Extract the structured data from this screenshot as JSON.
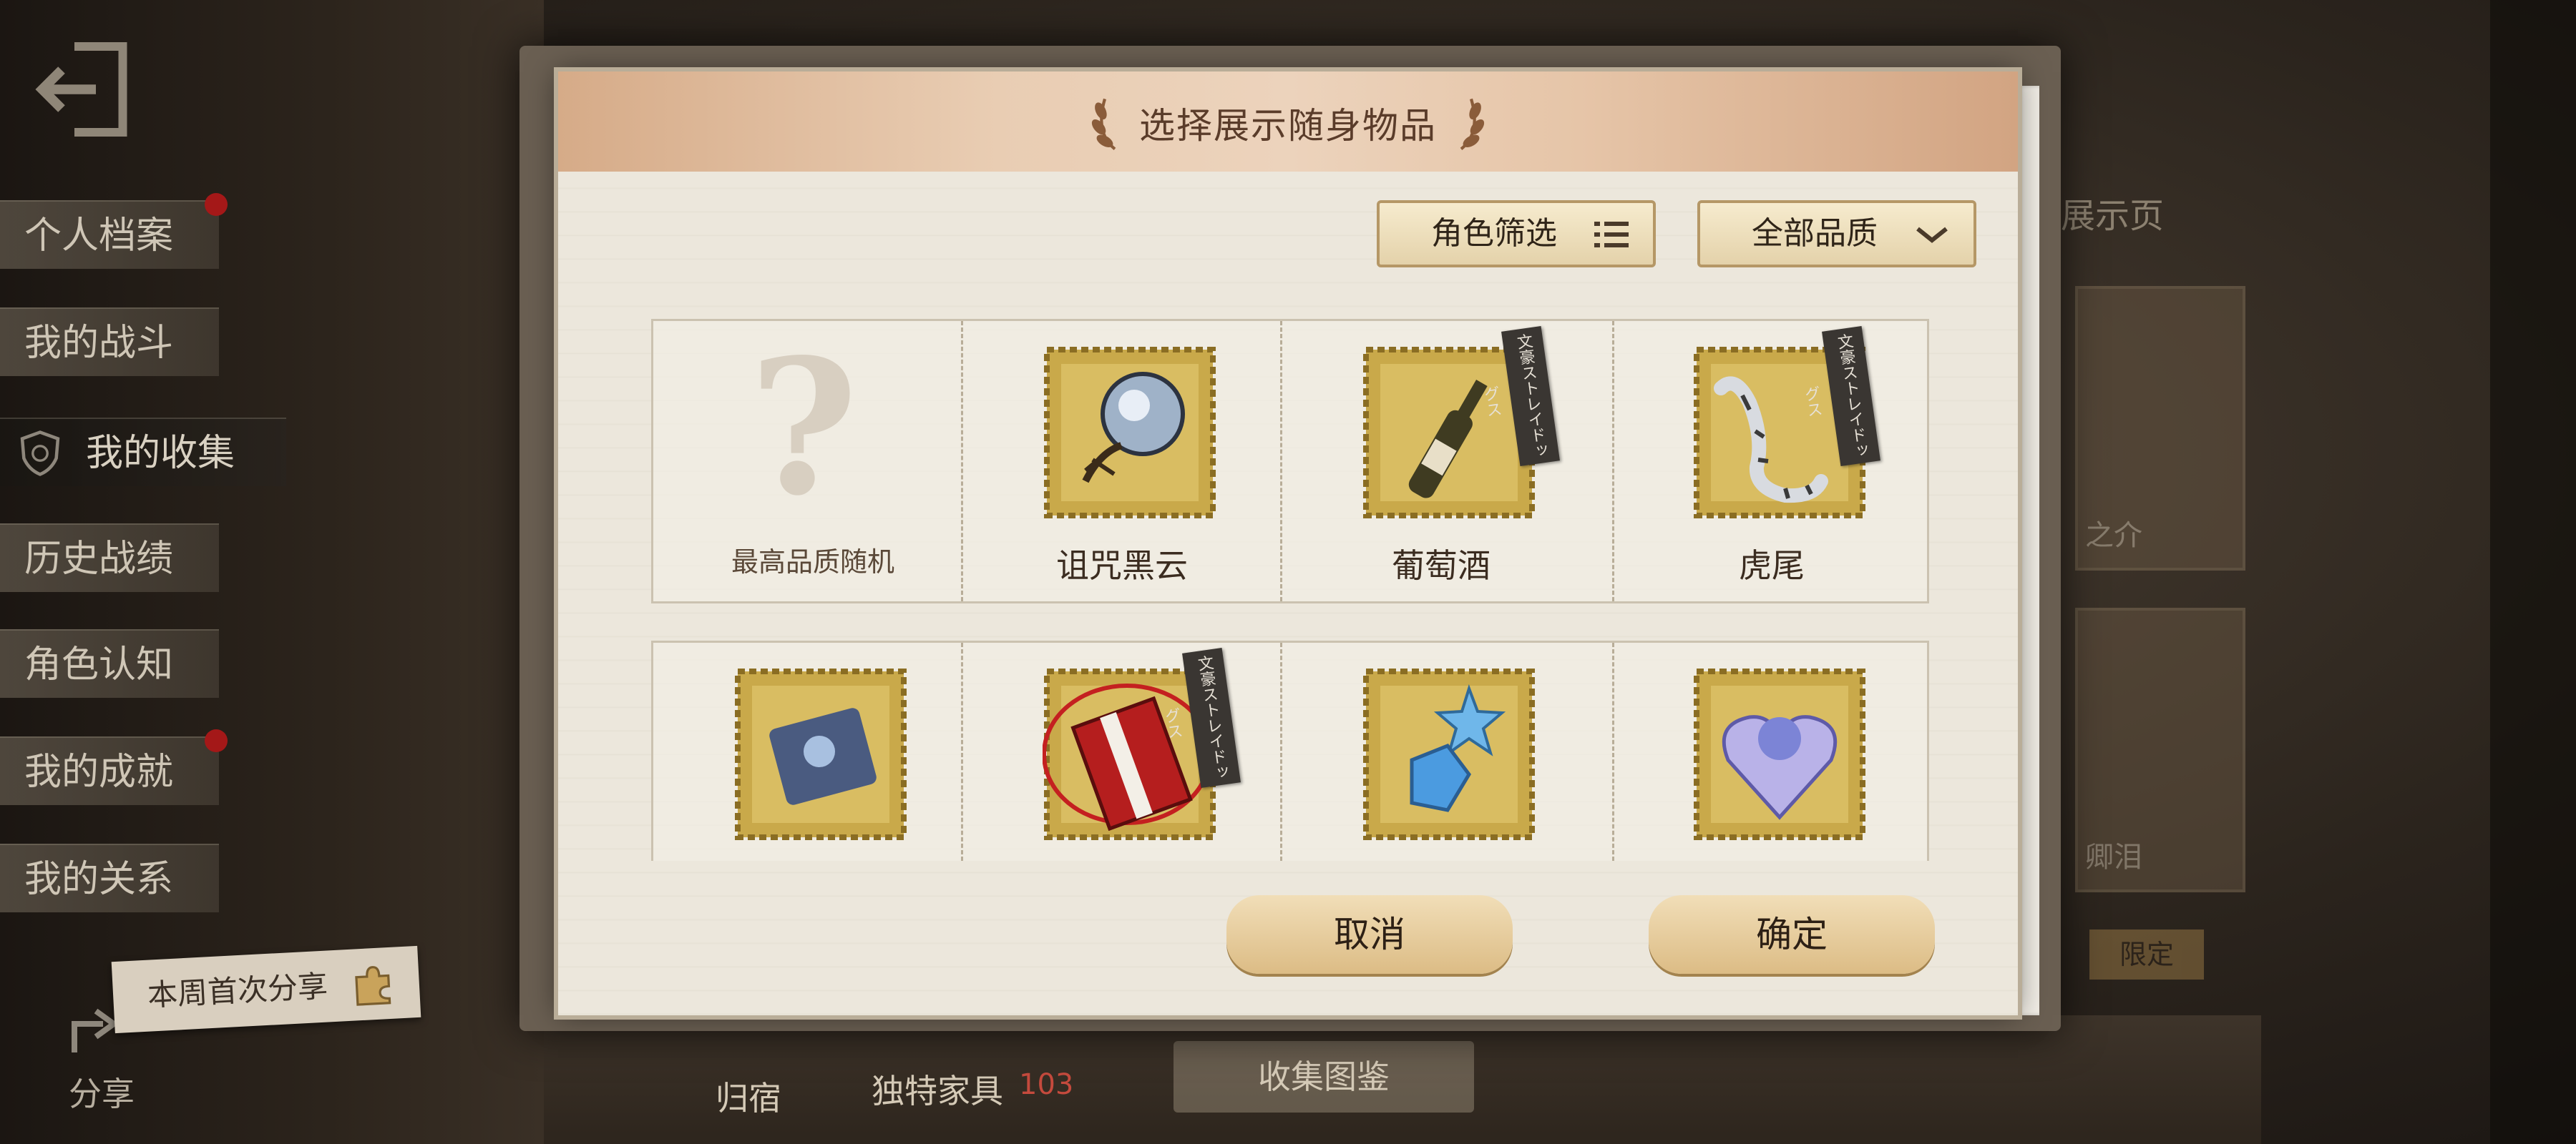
{
  "left_menu": {
    "items": [
      {
        "label": "个人档案",
        "badge": true
      },
      {
        "label": "我的战斗",
        "badge": false
      },
      {
        "label": "我的收集",
        "badge": false,
        "active": true
      },
      {
        "label": "历史战绩",
        "badge": false
      },
      {
        "label": "角色认知",
        "badge": false
      },
      {
        "label": "我的成就",
        "badge": true
      },
      {
        "label": "我的关系",
        "badge": false
      }
    ],
    "share_banner": "本周首次分享",
    "share_label": "分享"
  },
  "bottom_bar": {
    "dorm_label": "归宿",
    "furniture_label": "独特家具",
    "furniture_count": "103",
    "collection_button": "收集图鉴"
  },
  "background_panel": {
    "title_fragment": "展示页",
    "card_text_1": "之介",
    "card_text_2": "卿泪",
    "card_badge": "限定"
  },
  "dialog": {
    "title": "选择展示随身物品",
    "role_filter_label": "角色筛选",
    "quality_filter_label": "全部品质",
    "items": [
      {
        "label": "最高品质随机",
        "icon": "question-mark",
        "tag": ""
      },
      {
        "label": "诅咒黑云",
        "icon": "crystal-ball",
        "tag": ""
      },
      {
        "label": "葡萄酒",
        "icon": "wine-bottle",
        "tag": "文豪ストレイドッグス"
      },
      {
        "label": "虎尾",
        "icon": "tiger-tail",
        "tag": "文豪ストレイドッグス"
      },
      {
        "label": "",
        "icon": "blue-gem-card",
        "tag": ""
      },
      {
        "label": "",
        "icon": "red-book",
        "tag": "文豪ストレイドッグス"
      },
      {
        "label": "",
        "icon": "blue-star-gem",
        "tag": ""
      },
      {
        "label": "",
        "icon": "crystal-heart",
        "tag": ""
      }
    ],
    "cancel_label": "取消",
    "confirm_label": "确定"
  },
  "colors": {
    "badge_red": "#a41818",
    "stamp_gold": "#c9a94a",
    "header_peach": "#e6c5a8"
  }
}
